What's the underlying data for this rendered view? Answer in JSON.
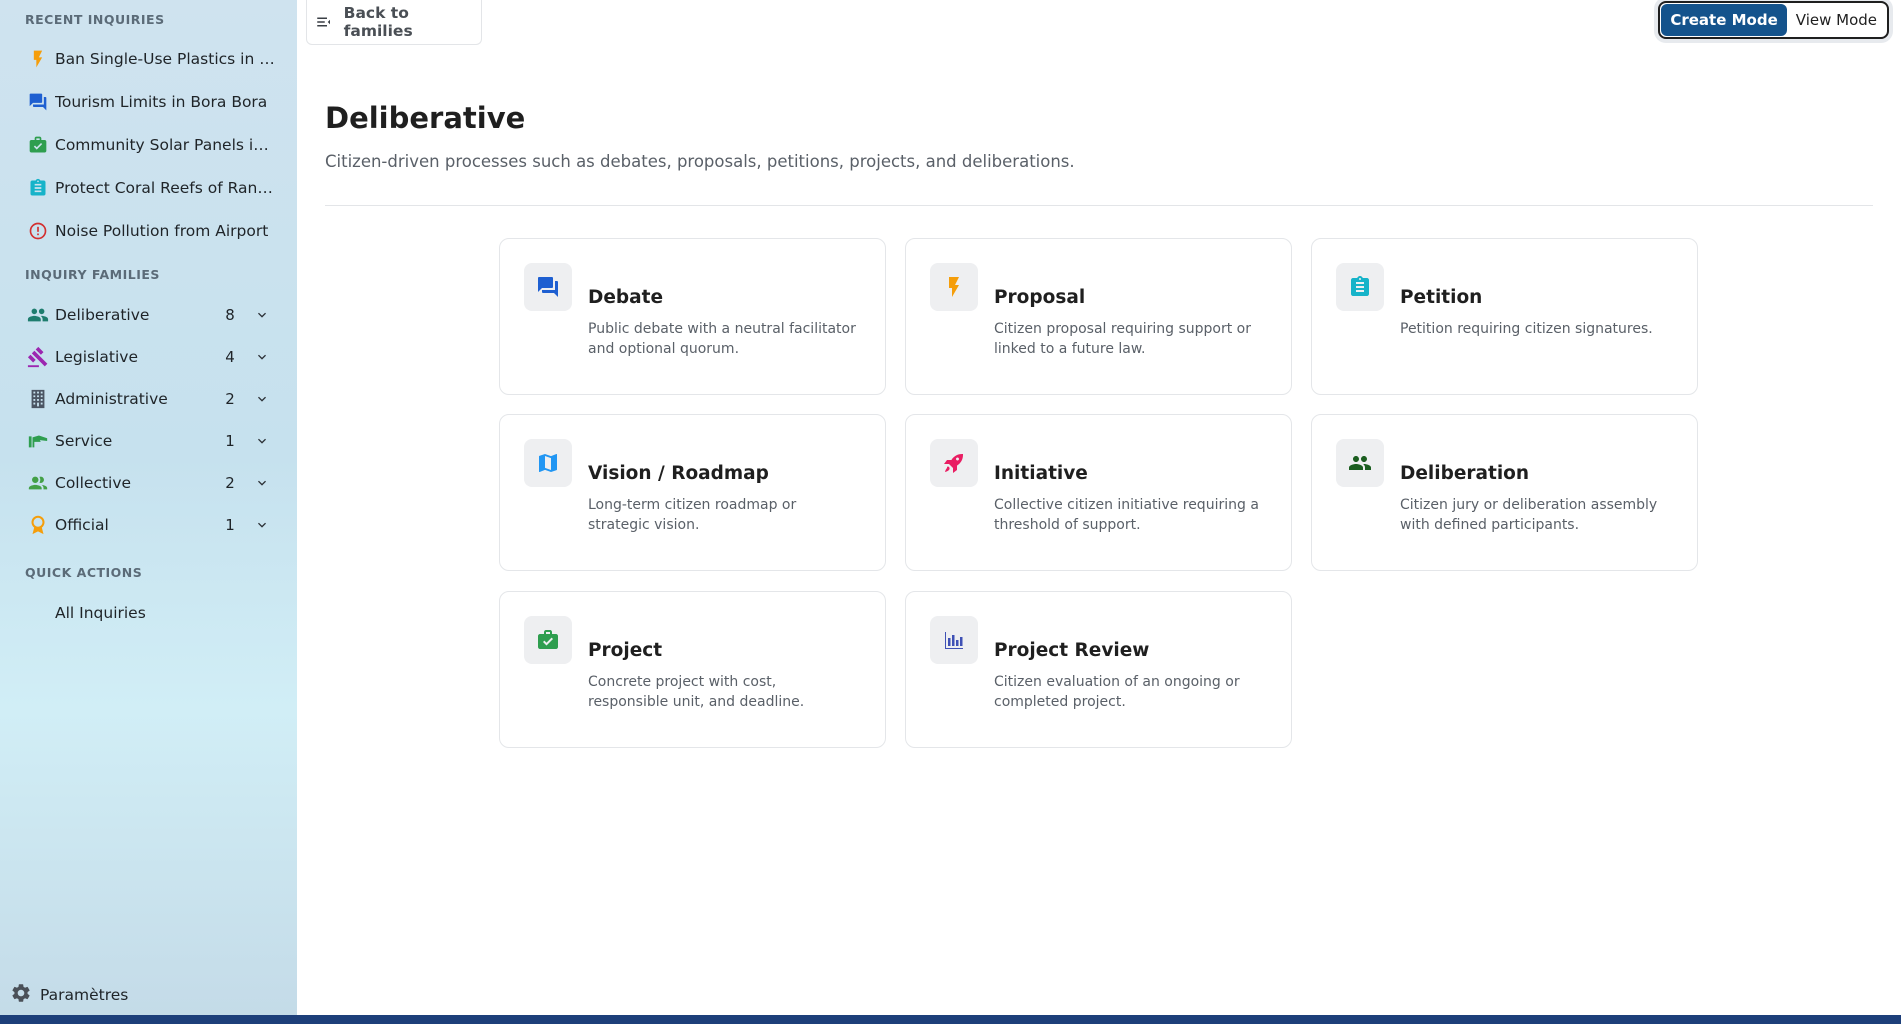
{
  "sidebar": {
    "recent_title": "RECENT INQUIRIES",
    "recent": [
      {
        "label": "Ban Single-Use Plastics in Moorea",
        "icon": "bolt-icon",
        "color": "#f59e0b"
      },
      {
        "label": "Tourism Limits in Bora Bora",
        "icon": "forum-icon",
        "color": "#1e5fd1"
      },
      {
        "label": "Community Solar Panels in Tahiti",
        "icon": "briefcase-check-icon",
        "color": "#2e9e4f"
      },
      {
        "label": "Protect Coral Reefs of Rangiroa",
        "icon": "clipboard-icon",
        "color": "#16b3c9"
      },
      {
        "label": "Noise Pollution from Airport",
        "icon": "alert-circle-icon",
        "color": "#d32f2f"
      }
    ],
    "families_title": "INQUIRY FAMILIES",
    "families": [
      {
        "label": "Deliberative",
        "count": "8",
        "icon": "people-icon",
        "color": "#1e7d6e"
      },
      {
        "label": "Legislative",
        "count": "4",
        "icon": "gavel-icon",
        "color": "#9c27b0"
      },
      {
        "label": "Administrative",
        "count": "2",
        "icon": "building-icon",
        "color": "#4b5563"
      },
      {
        "label": "Service",
        "count": "1",
        "icon": "hand-icon",
        "color": "#2e9e4f"
      },
      {
        "label": "Collective",
        "count": "2",
        "icon": "group-icon",
        "color": "#43a047"
      },
      {
        "label": "Official",
        "count": "1",
        "icon": "award-icon",
        "color": "#f59e0b"
      }
    ],
    "quick_title": "QUICK ACTIONS",
    "quick": [
      {
        "label": "All Inquiries"
      }
    ],
    "settings_label": "Paramètres"
  },
  "header": {
    "back_label": "Back to families",
    "create_mode": "Create Mode",
    "view_mode": "View Mode"
  },
  "main": {
    "title": "Deliberative",
    "description": "Citizen-driven processes such as debates, proposals, petitions, projects, and deliberations.",
    "cards": [
      {
        "title": "Debate",
        "desc": "Public debate with a neutral facilitator and optional quorum.",
        "icon": "forum-icon",
        "color": "#1e5fd1"
      },
      {
        "title": "Proposal",
        "desc": "Citizen proposal requiring support or linked to a future law.",
        "icon": "bolt-icon",
        "color": "#f59e0b"
      },
      {
        "title": "Petition",
        "desc": "Petition requiring citizen signatures.",
        "icon": "clipboard-icon",
        "color": "#16b3c9"
      },
      {
        "title": "Vision / Roadmap",
        "desc": "Long-term citizen roadmap or strategic vision.",
        "icon": "map-icon",
        "color": "#2196f3"
      },
      {
        "title": "Initiative",
        "desc": "Collective citizen initiative requiring a threshold of support.",
        "icon": "rocket-icon",
        "color": "#e91e63"
      },
      {
        "title": "Deliberation",
        "desc": "Citizen jury or deliberation assembly with defined participants.",
        "icon": "people-icon",
        "color": "#1b5e20"
      },
      {
        "title": "Project",
        "desc": "Concrete project with cost, responsible unit, and deadline.",
        "icon": "briefcase-check-icon",
        "color": "#2e9e4f"
      },
      {
        "title": "Project Review",
        "desc": "Citizen evaluation of an ongoing or completed project.",
        "icon": "bar-chart-icon",
        "color": "#3f51b5"
      }
    ]
  }
}
